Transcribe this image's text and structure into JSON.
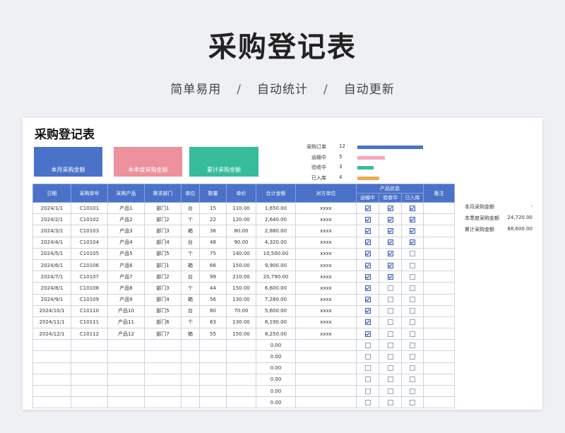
{
  "hero": {
    "title": "采购登记表",
    "tags": [
      "简单易用",
      "自动统计",
      "自动更新"
    ],
    "separator": "/"
  },
  "sheet": {
    "title": "采购登记表",
    "cards": [
      {
        "label": "本月采购金额",
        "color": "#4a72c9"
      },
      {
        "label": "本季度采购金额",
        "color": "#ee919d"
      },
      {
        "label": "累计采购金额",
        "color": "#37bc9b"
      }
    ],
    "status": [
      {
        "label": "采购订单",
        "value": "12",
        "fill": 1.0,
        "color": "#4a72c9"
      },
      {
        "label": "运输中",
        "value": "5",
        "fill": 0.42,
        "color": "#f4a6bd"
      },
      {
        "label": "验收中",
        "value": "3",
        "fill": 0.25,
        "color": "#37bc9b"
      },
      {
        "label": "已入库",
        "value": "4",
        "fill": 0.33,
        "color": "#f0a94f"
      }
    ],
    "headers": [
      "日期",
      "采购单号",
      "采购产品",
      "需求部门",
      "单位",
      "数量",
      "单价",
      "合计金额",
      "对方单位",
      "产品状态",
      "备注"
    ],
    "status_subheaders": [
      "运输中",
      "验收中",
      "已入库"
    ],
    "rows": [
      {
        "date": "2024/1/1",
        "no": "C10101",
        "product": "产品1",
        "dept": "部门1",
        "unit": "台",
        "qty": "15",
        "price": "110.00",
        "total": "1,650.00",
        "party": "xxxx",
        "s": [
          1,
          1,
          1
        ]
      },
      {
        "date": "2024/2/1",
        "no": "C10102",
        "product": "产品2",
        "dept": "部门2",
        "unit": "个",
        "qty": "22",
        "price": "120.00",
        "total": "2,640.00",
        "party": "xxxx",
        "s": [
          1,
          1,
          1
        ]
      },
      {
        "date": "2024/3/1",
        "no": "C10103",
        "product": "产品3",
        "dept": "部门3",
        "unit": "箱",
        "qty": "36",
        "price": "80.00",
        "total": "2,880.00",
        "party": "xxxx",
        "s": [
          1,
          1,
          1
        ]
      },
      {
        "date": "2024/4/1",
        "no": "C10104",
        "product": "产品4",
        "dept": "部门4",
        "unit": "台",
        "qty": "48",
        "price": "90.00",
        "total": "4,320.00",
        "party": "xxxx",
        "s": [
          1,
          1,
          1
        ]
      },
      {
        "date": "2024/5/1",
        "no": "C10105",
        "product": "产品5",
        "dept": "部门5",
        "unit": "个",
        "qty": "75",
        "price": "140.00",
        "total": "10,500.00",
        "party": "xxxx",
        "s": [
          1,
          1,
          0
        ]
      },
      {
        "date": "2024/6/1",
        "no": "C10106",
        "product": "产品6",
        "dept": "部门1",
        "unit": "箱",
        "qty": "66",
        "price": "150.00",
        "total": "9,900.00",
        "party": "xxxx",
        "s": [
          1,
          1,
          0
        ]
      },
      {
        "date": "2024/7/1",
        "no": "C10107",
        "product": "产品7",
        "dept": "部门2",
        "unit": "台",
        "qty": "99",
        "price": "210.00",
        "total": "20,790.00",
        "party": "xxxx",
        "s": [
          1,
          1,
          0
        ]
      },
      {
        "date": "2024/8/1",
        "no": "C10108",
        "product": "产品8",
        "dept": "部门3",
        "unit": "个",
        "qty": "44",
        "price": "150.00",
        "total": "6,600.00",
        "party": "xxxx",
        "s": [
          1,
          0,
          0
        ]
      },
      {
        "date": "2024/9/1",
        "no": "C10109",
        "product": "产品9",
        "dept": "部门4",
        "unit": "箱",
        "qty": "56",
        "price": "130.00",
        "total": "7,280.00",
        "party": "xxxx",
        "s": [
          1,
          0,
          0
        ]
      },
      {
        "date": "2024/10/1",
        "no": "C10110",
        "product": "产品10",
        "dept": "部门5",
        "unit": "台",
        "qty": "80",
        "price": "70.00",
        "total": "5,600.00",
        "party": "xxxx",
        "s": [
          1,
          0,
          0
        ]
      },
      {
        "date": "2024/11/1",
        "no": "C10111",
        "product": "产品11",
        "dept": "部门6",
        "unit": "个",
        "qty": "63",
        "price": "130.00",
        "total": "8,190.00",
        "party": "xxxx",
        "s": [
          1,
          0,
          0
        ]
      },
      {
        "date": "2024/12/1",
        "no": "C10112",
        "product": "产品12",
        "dept": "部门7",
        "unit": "箱",
        "qty": "55",
        "price": "150.00",
        "total": "8,250.00",
        "party": "xxxx",
        "s": [
          1,
          0,
          0
        ]
      }
    ],
    "empty_total": "0.00",
    "summary": [
      {
        "label": "本月采购金额",
        "value": "-"
      },
      {
        "label": "本季度采购金额",
        "value": "24,720.00"
      },
      {
        "label": "累计采购金额",
        "value": "88,600.00"
      }
    ]
  }
}
